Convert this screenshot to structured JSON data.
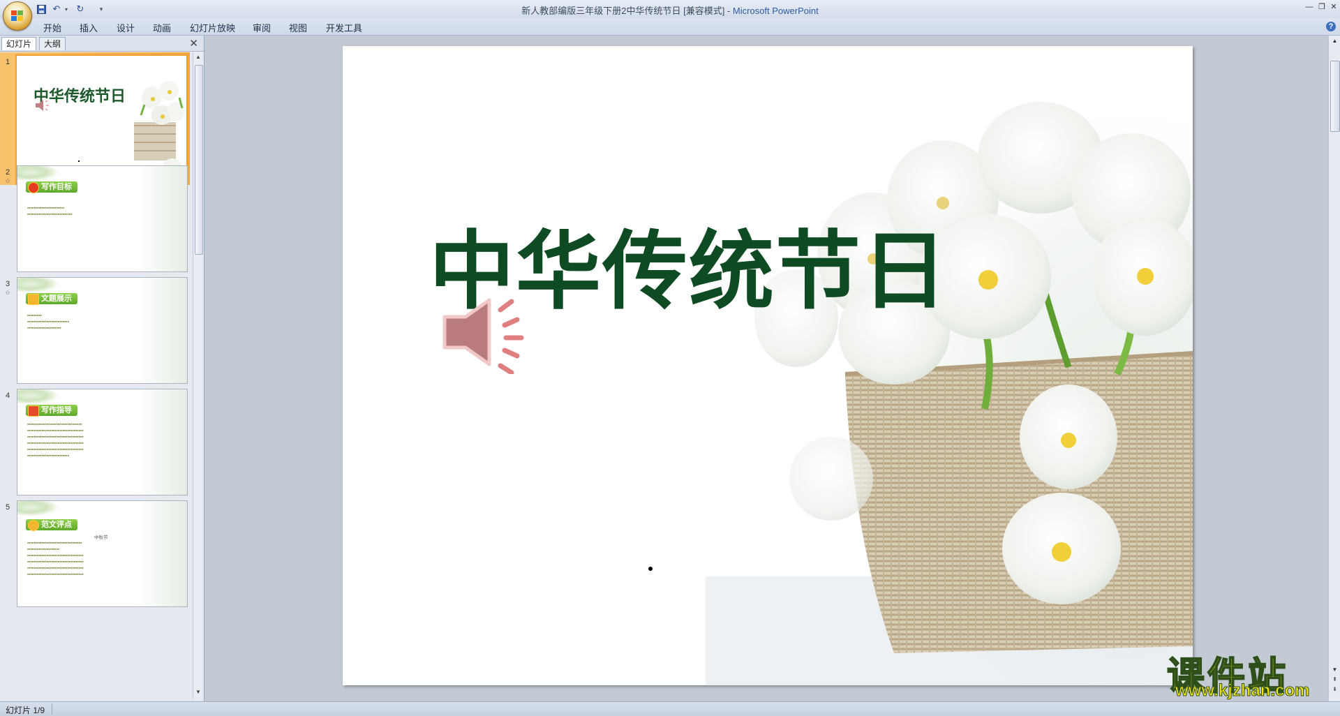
{
  "window": {
    "title_doc": "新人教部编版三年级下册2中华传统节日 [兼容模式] - ",
    "title_app": "Microsoft PowerPoint"
  },
  "ribbon": {
    "tabs": [
      "开始",
      "插入",
      "设计",
      "动画",
      "幻灯片放映",
      "审阅",
      "视图",
      "开发工具"
    ]
  },
  "panel": {
    "tabs": [
      "幻灯片",
      "大纲"
    ]
  },
  "thumbnails": [
    {
      "num": "1",
      "title": "中华传统节日"
    },
    {
      "num": "2",
      "badge": "写作目标"
    },
    {
      "num": "3",
      "badge": "文题展示"
    },
    {
      "num": "4",
      "badge": "写作指导"
    },
    {
      "num": "5",
      "badge": "范文评点",
      "subtitle": "中秋节"
    }
  ],
  "slide": {
    "title": "中华传统节日"
  },
  "watermark": {
    "text": "课件站",
    "url": "www.kjzhan.com"
  },
  "status": {
    "slide_indicator": "幻灯片 1/9"
  }
}
